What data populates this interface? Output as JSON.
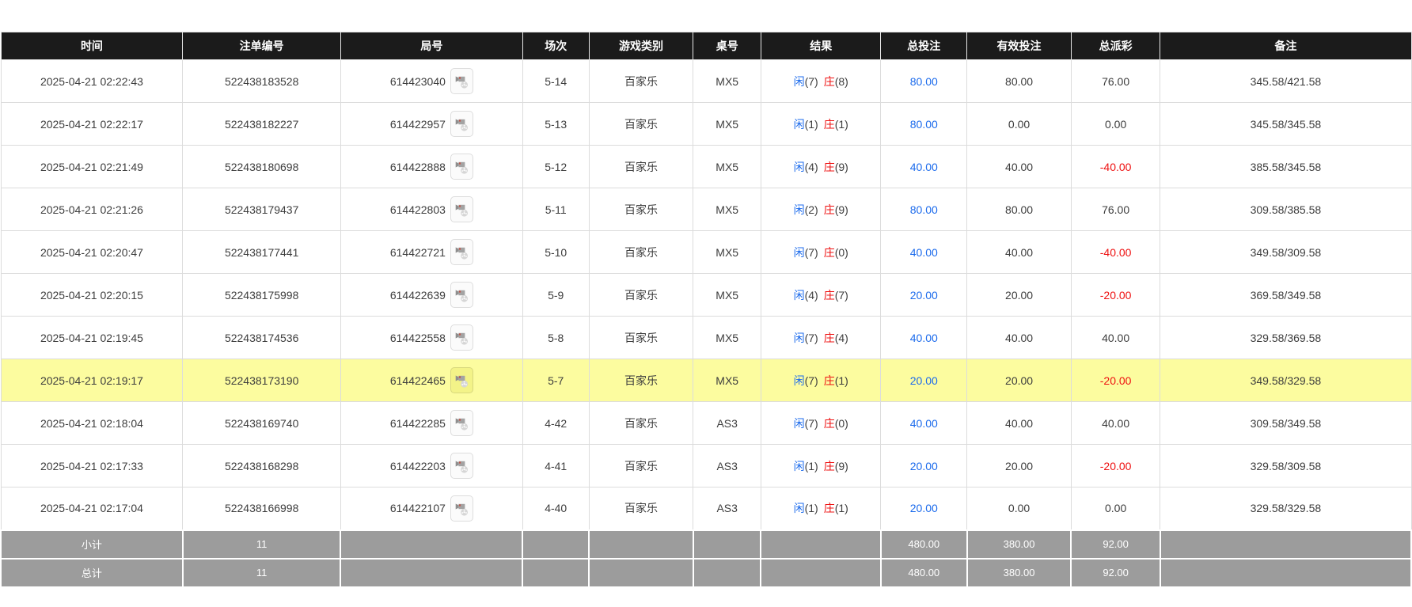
{
  "colors": {
    "blue": "#1c6bec",
    "red": "#ee1111",
    "highlight": "#fcfc9f",
    "header_bg": "#1b1b1b",
    "summary_bg": "#9c9c9c"
  },
  "icons": {
    "video_replay": "video-replay-icon"
  },
  "table": {
    "columns": [
      {
        "key": "time",
        "label": "时间"
      },
      {
        "key": "bet-id",
        "label": "注单编号"
      },
      {
        "key": "round-no",
        "label": "局号"
      },
      {
        "key": "session",
        "label": "场次"
      },
      {
        "key": "game-type",
        "label": "游戏类别"
      },
      {
        "key": "table-no",
        "label": "桌号"
      },
      {
        "key": "result",
        "label": "结果"
      },
      {
        "key": "total-bet",
        "label": "总投注"
      },
      {
        "key": "valid-bet",
        "label": "有效投注"
      },
      {
        "key": "total-payout",
        "label": "总派彩"
      },
      {
        "key": "remark",
        "label": "备注"
      }
    ],
    "rows": [
      {
        "time": "2025-04-21 02:22:43",
        "bet_id": "522438183528",
        "round_no": "614423040",
        "session": "5-14",
        "game_type": "百家乐",
        "table_no": "MX5",
        "result": {
          "player_label": "闲",
          "player_score": "(7)",
          "banker_label": "庄",
          "banker_score": "(8)"
        },
        "total_bet": "80.00",
        "valid_bet": "80.00",
        "total_payout": "76.00",
        "remark": "345.58/421.58",
        "highlighted": false
      },
      {
        "time": "2025-04-21 02:22:17",
        "bet_id": "522438182227",
        "round_no": "614422957",
        "session": "5-13",
        "game_type": "百家乐",
        "table_no": "MX5",
        "result": {
          "player_label": "闲",
          "player_score": "(1)",
          "banker_label": "庄",
          "banker_score": "(1)"
        },
        "total_bet": "80.00",
        "valid_bet": "0.00",
        "total_payout": "0.00",
        "remark": "345.58/345.58",
        "highlighted": false
      },
      {
        "time": "2025-04-21 02:21:49",
        "bet_id": "522438180698",
        "round_no": "614422888",
        "session": "5-12",
        "game_type": "百家乐",
        "table_no": "MX5",
        "result": {
          "player_label": "闲",
          "player_score": "(4)",
          "banker_label": "庄",
          "banker_score": "(9)"
        },
        "total_bet": "40.00",
        "valid_bet": "40.00",
        "total_payout": "-40.00",
        "remark": "385.58/345.58",
        "highlighted": false
      },
      {
        "time": "2025-04-21 02:21:26",
        "bet_id": "522438179437",
        "round_no": "614422803",
        "session": "5-11",
        "game_type": "百家乐",
        "table_no": "MX5",
        "result": {
          "player_label": "闲",
          "player_score": "(2)",
          "banker_label": "庄",
          "banker_score": "(9)"
        },
        "total_bet": "80.00",
        "valid_bet": "80.00",
        "total_payout": "76.00",
        "remark": "309.58/385.58",
        "highlighted": false
      },
      {
        "time": "2025-04-21 02:20:47",
        "bet_id": "522438177441",
        "round_no": "614422721",
        "session": "5-10",
        "game_type": "百家乐",
        "table_no": "MX5",
        "result": {
          "player_label": "闲",
          "player_score": "(7)",
          "banker_label": "庄",
          "banker_score": "(0)"
        },
        "total_bet": "40.00",
        "valid_bet": "40.00",
        "total_payout": "-40.00",
        "remark": "349.58/309.58",
        "highlighted": false
      },
      {
        "time": "2025-04-21 02:20:15",
        "bet_id": "522438175998",
        "round_no": "614422639",
        "session": "5-9",
        "game_type": "百家乐",
        "table_no": "MX5",
        "result": {
          "player_label": "闲",
          "player_score": "(4)",
          "banker_label": "庄",
          "banker_score": "(7)"
        },
        "total_bet": "20.00",
        "valid_bet": "20.00",
        "total_payout": "-20.00",
        "remark": "369.58/349.58",
        "highlighted": false
      },
      {
        "time": "2025-04-21 02:19:45",
        "bet_id": "522438174536",
        "round_no": "614422558",
        "session": "5-8",
        "game_type": "百家乐",
        "table_no": "MX5",
        "result": {
          "player_label": "闲",
          "player_score": "(7)",
          "banker_label": "庄",
          "banker_score": "(4)"
        },
        "total_bet": "40.00",
        "valid_bet": "40.00",
        "total_payout": "40.00",
        "remark": "329.58/369.58",
        "highlighted": false
      },
      {
        "time": "2025-04-21 02:19:17",
        "bet_id": "522438173190",
        "round_no": "614422465",
        "session": "5-7",
        "game_type": "百家乐",
        "table_no": "MX5",
        "result": {
          "player_label": "闲",
          "player_score": "(7)",
          "banker_label": "庄",
          "banker_score": "(1)"
        },
        "total_bet": "20.00",
        "valid_bet": "20.00",
        "total_payout": "-20.00",
        "remark": "349.58/329.58",
        "highlighted": true
      },
      {
        "time": "2025-04-21 02:18:04",
        "bet_id": "522438169740",
        "round_no": "614422285",
        "session": "4-42",
        "game_type": "百家乐",
        "table_no": "AS3",
        "result": {
          "player_label": "闲",
          "player_score": "(7)",
          "banker_label": "庄",
          "banker_score": "(0)"
        },
        "total_bet": "40.00",
        "valid_bet": "40.00",
        "total_payout": "40.00",
        "remark": "309.58/349.58",
        "highlighted": false
      },
      {
        "time": "2025-04-21 02:17:33",
        "bet_id": "522438168298",
        "round_no": "614422203",
        "session": "4-41",
        "game_type": "百家乐",
        "table_no": "AS3",
        "result": {
          "player_label": "闲",
          "player_score": "(1)",
          "banker_label": "庄",
          "banker_score": "(9)"
        },
        "total_bet": "20.00",
        "valid_bet": "20.00",
        "total_payout": "-20.00",
        "remark": "329.58/309.58",
        "highlighted": false
      },
      {
        "time": "2025-04-21 02:17:04",
        "bet_id": "522438166998",
        "round_no": "614422107",
        "session": "4-40",
        "game_type": "百家乐",
        "table_no": "AS3",
        "result": {
          "player_label": "闲",
          "player_score": "(1)",
          "banker_label": "庄",
          "banker_score": "(1)"
        },
        "total_bet": "20.00",
        "valid_bet": "0.00",
        "total_payout": "0.00",
        "remark": "329.58/329.58",
        "highlighted": false
      }
    ],
    "summary": [
      {
        "key": "subtotal",
        "label": "小计",
        "count": "11",
        "total_bet": "480.00",
        "valid_bet": "380.00",
        "total_payout": "92.00"
      },
      {
        "key": "total",
        "label": "总计",
        "count": "11",
        "total_bet": "480.00",
        "valid_bet": "380.00",
        "total_payout": "92.00"
      }
    ]
  }
}
